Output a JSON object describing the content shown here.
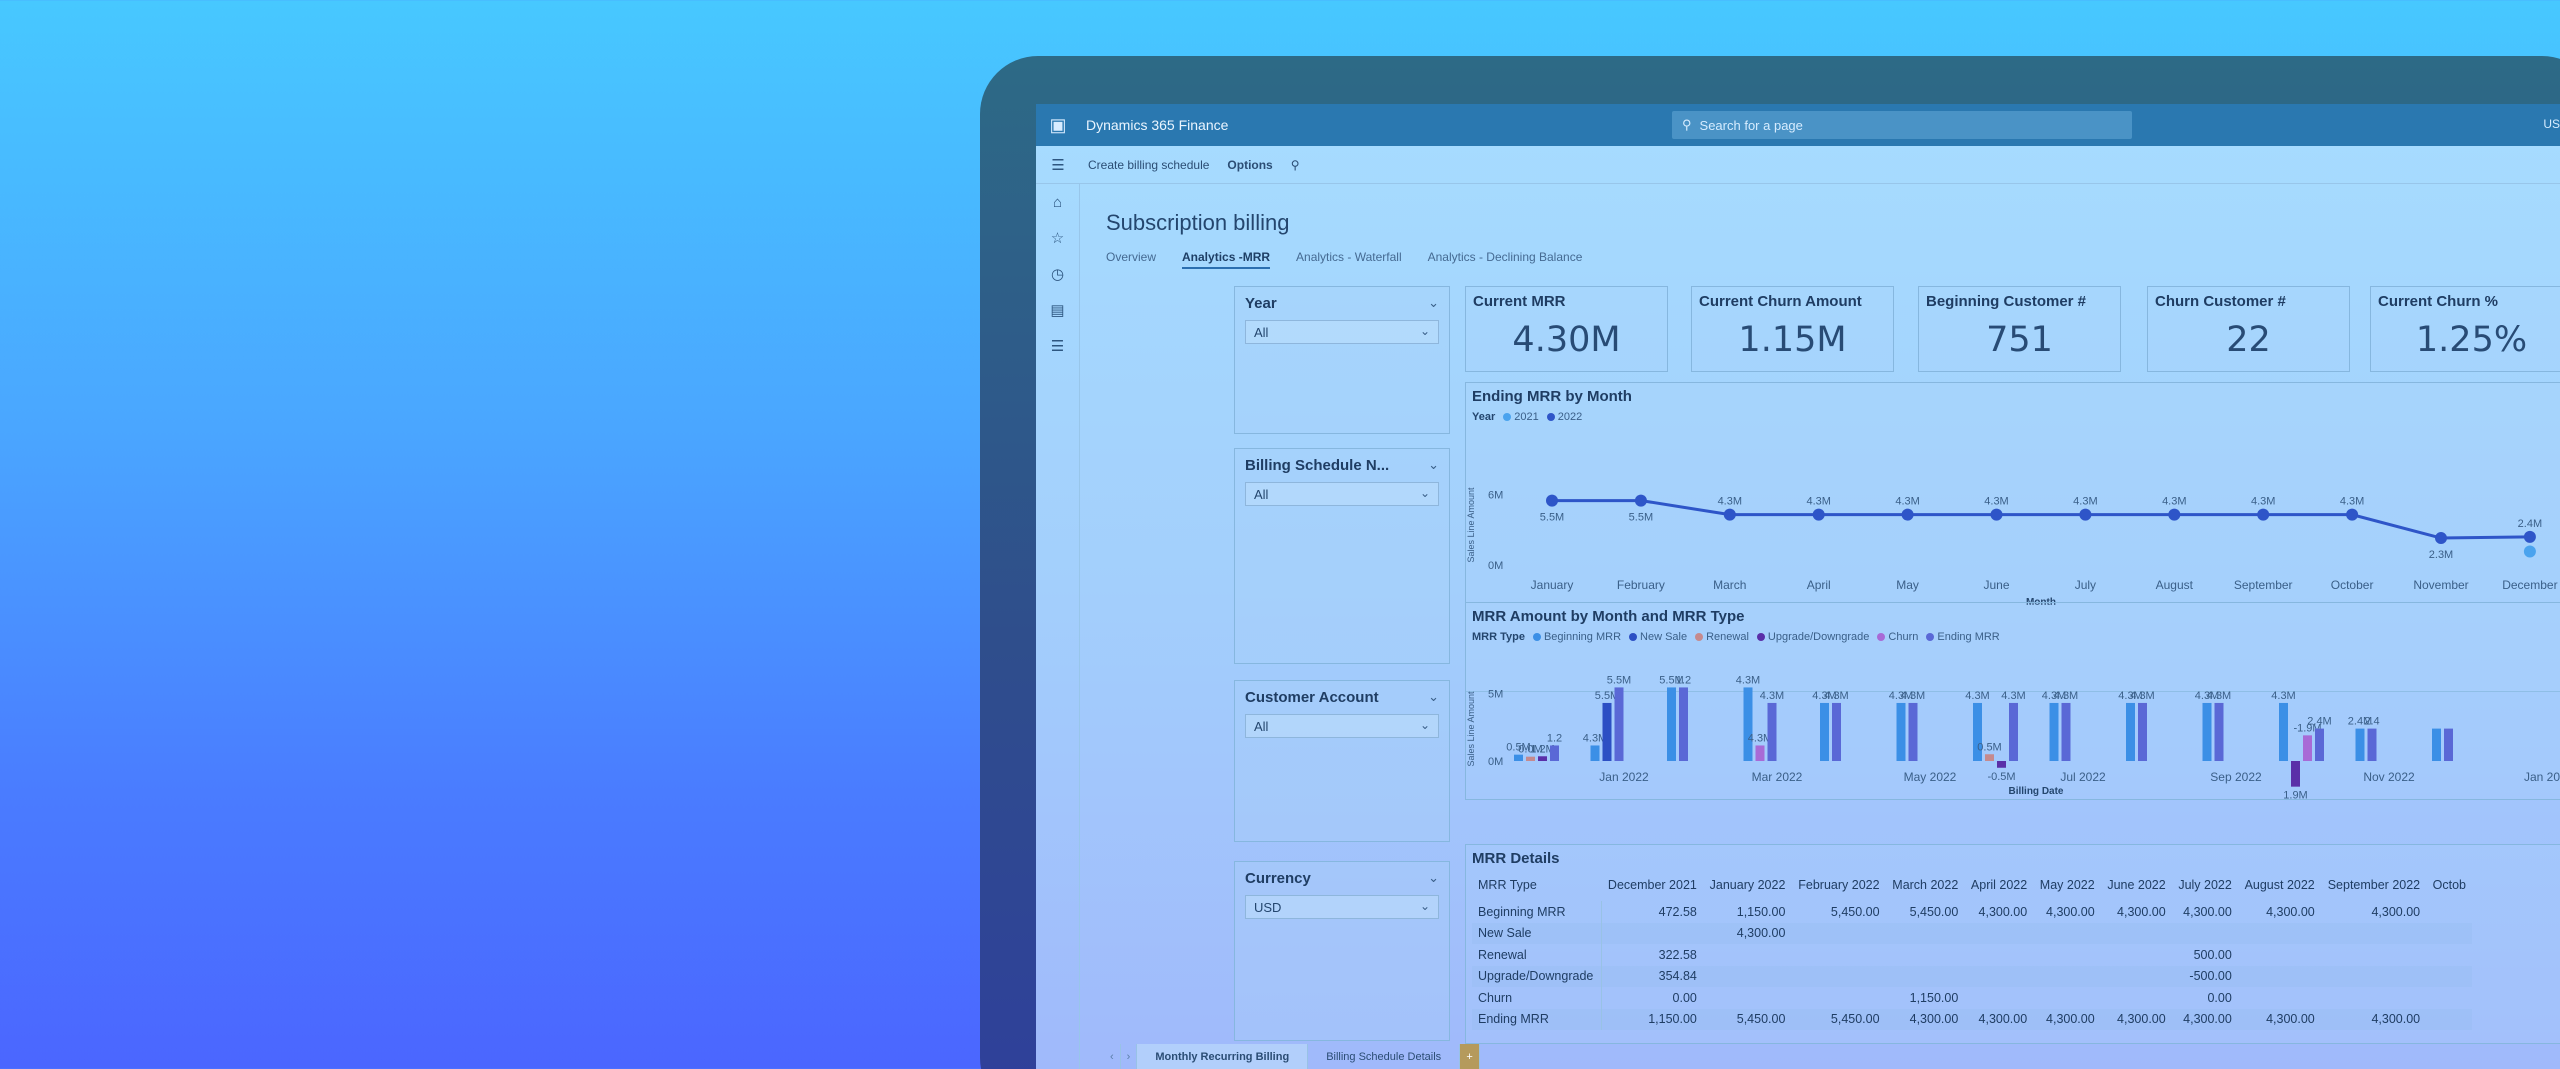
{
  "app": {
    "title": "Dynamics 365 Finance",
    "search_placeholder": "Search for a page",
    "user_initials": "US"
  },
  "command_bar": {
    "create_billing_schedule": "Create billing schedule",
    "options": "Options"
  },
  "page": {
    "title": "Subscription billing",
    "tabs": [
      {
        "label": "Overview",
        "active": false
      },
      {
        "label": "Analytics -MRR",
        "active": true
      },
      {
        "label": "Analytics - Waterfall",
        "active": false
      },
      {
        "label": "Analytics - Declining Balance",
        "active": false
      }
    ]
  },
  "slicers": [
    {
      "label": "Year",
      "value": "All"
    },
    {
      "label": "Billing Schedule N...",
      "value": "All"
    },
    {
      "label": "Customer Account",
      "value": "All"
    },
    {
      "label": "Currency",
      "value": "USD"
    }
  ],
  "kpis": [
    {
      "label": "Current MRR",
      "value": "4.30M"
    },
    {
      "label": "Current Churn Amount",
      "value": "1.15M"
    },
    {
      "label": "Beginning Customer #",
      "value": "751"
    },
    {
      "label": "Churn Customer #",
      "value": "22"
    },
    {
      "label": "Current Churn %",
      "value": "1.25%"
    }
  ],
  "colors": {
    "series_2021": "#4aa3ee",
    "series_2022": "#2e55c8",
    "beginning_mrr": "#3b8fe6",
    "new_sale": "#2c4fc4",
    "renewal": "#c58a8e",
    "upgrade_downgrade": "#5a2fa8",
    "churn": "#a86ad6",
    "ending_mrr": "#5a68d6"
  },
  "chart_data": [
    {
      "type": "line",
      "title": "Ending MRR by Month",
      "legend_title": "Year",
      "xlabel": "Month",
      "ylabel": "Sales Line Amount",
      "y_ticks": [
        "6M",
        "0M"
      ],
      "categories": [
        "January",
        "February",
        "March",
        "April",
        "May",
        "June",
        "July",
        "August",
        "September",
        "October",
        "November",
        "December"
      ],
      "series": [
        {
          "name": "2021",
          "values": [
            null,
            null,
            null,
            null,
            null,
            null,
            null,
            null,
            null,
            null,
            null,
            1.15
          ],
          "labels": [
            "",
            "",
            "",
            "",
            "",
            "",
            "",
            "",
            "",
            "",
            "",
            ""
          ]
        },
        {
          "name": "2022",
          "values": [
            5.5,
            5.5,
            4.3,
            4.3,
            4.3,
            4.3,
            4.3,
            4.3,
            4.3,
            4.3,
            2.3,
            2.4
          ],
          "labels": [
            "5.5M",
            "5.5M",
            "4.3M",
            "4.3M",
            "4.3M",
            "4.3M",
            "4.3M",
            "4.3M",
            "4.3M",
            "4.3M",
            "2.3M",
            "2.4M"
          ]
        }
      ]
    },
    {
      "type": "bar",
      "title": "MRR Amount by Month and MRR Type",
      "legend_title": "MRR Type",
      "xlabel": "Billing Date",
      "ylabel": "Sales Line Amount",
      "y_ticks": [
        "5M",
        "0M"
      ],
      "x_ticks": [
        "Jan 2022",
        "Mar 2022",
        "May 2022",
        "Jul 2022",
        "Sep 2022",
        "Nov 2022",
        "Jan 20"
      ],
      "series_names": [
        "Beginning MRR",
        "New Sale",
        "Renewal",
        "Upgrade/Downgrade",
        "Churn",
        "Ending MRR"
      ],
      "months": [
        {
          "values": [
            0.47,
            0,
            0.32,
            0.35,
            0,
            1.15
          ]
        },
        {
          "values": [
            1.15,
            4.3,
            0,
            0,
            0,
            5.45
          ]
        },
        {
          "values": [
            5.45,
            0,
            0,
            0,
            0,
            5.45
          ]
        },
        {
          "values": [
            5.45,
            0,
            0,
            0,
            1.15,
            4.3
          ]
        },
        {
          "values": [
            4.3,
            0,
            0,
            0,
            0,
            4.3
          ]
        },
        {
          "values": [
            4.3,
            0,
            0,
            0,
            0,
            4.3
          ]
        },
        {
          "values": [
            4.3,
            0,
            0.5,
            -0.5,
            0,
            4.3
          ]
        },
        {
          "values": [
            4.3,
            0,
            0,
            0,
            0,
            4.3
          ]
        },
        {
          "values": [
            4.3,
            0,
            0,
            0,
            0,
            4.3
          ]
        },
        {
          "values": [
            4.3,
            0,
            0,
            0,
            0,
            4.3
          ]
        },
        {
          "values": [
            4.3,
            0,
            0,
            -1.9,
            1.9,
            2.4
          ]
        },
        {
          "values": [
            2.4,
            0,
            0,
            0,
            0,
            2.4
          ]
        },
        {
          "values": [
            2.4,
            0,
            0,
            0,
            0,
            2.4
          ]
        }
      ],
      "labels": [
        "0.5M",
        "0.0M",
        "1.2M",
        "1.2",
        "4.3M",
        "5.5M",
        "5.5M",
        "5.5M",
        "1.2",
        "4.3M",
        "4.3M",
        "4.3M",
        "4.3M",
        "4.3M",
        "4.3M",
        "4.3M",
        "4.3M",
        "0.5M",
        "-0.5M",
        "4.3M",
        "4.3M",
        "4.3M",
        "4.3M",
        "4.3M",
        "4.3M",
        "4.3M",
        "4.3M",
        "1.9M",
        "-1.9M",
        "2.4M",
        "2.4M",
        "2.4"
      ]
    }
  ],
  "mrr_details": {
    "title": "MRR Details",
    "columns": [
      "MRR Type",
      "December 2021",
      "January 2022",
      "February 2022",
      "March 2022",
      "April 2022",
      "May 2022",
      "June 2022",
      "July 2022",
      "August 2022",
      "September 2022",
      "Octob"
    ],
    "rows": [
      [
        "Beginning MRR",
        "472.58",
        "1,150.00",
        "5,450.00",
        "5,450.00",
        "4,300.00",
        "4,300.00",
        "4,300.00",
        "4,300.00",
        "4,300.00",
        "4,300.00",
        ""
      ],
      [
        "New Sale",
        "",
        "4,300.00",
        "",
        "",
        "",
        "",
        "",
        "",
        "",
        "",
        ""
      ],
      [
        "Renewal",
        "322.58",
        "",
        "",
        "",
        "",
        "",
        "",
        "500.00",
        "",
        "",
        ""
      ],
      [
        "Upgrade/Downgrade",
        "354.84",
        "",
        "",
        "",
        "",
        "",
        "",
        "-500.00",
        "",
        "",
        ""
      ],
      [
        "Churn",
        "0.00",
        "",
        "",
        "1,150.00",
        "",
        "",
        "",
        "0.00",
        "",
        "",
        ""
      ],
      [
        "Ending MRR",
        "1,150.00",
        "5,450.00",
        "5,450.00",
        "4,300.00",
        "4,300.00",
        "4,300.00",
        "4,300.00",
        "4,300.00",
        "4,300.00",
        "4,300.00",
        ""
      ]
    ]
  },
  "bottom_tabs": [
    "Monthly Recurring Billing",
    "Billing Schedule Details"
  ]
}
